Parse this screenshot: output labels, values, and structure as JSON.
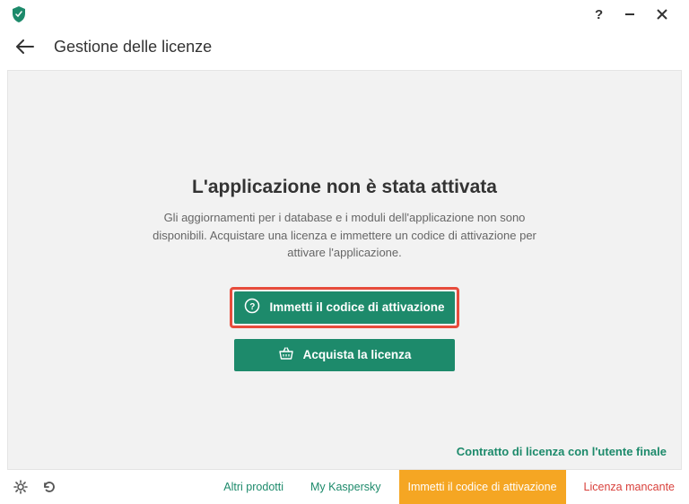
{
  "header": {
    "title": "Gestione delle licenze"
  },
  "main": {
    "heading": "L'applicazione non è stata attivata",
    "description": "Gli aggiornamenti per i database e i moduli dell'applicazione non sono disponibili. Acquistare una licenza e immettere un codice di attivazione per attivare l'applicazione.",
    "enter_code_label": "Immetti il codice di attivazione",
    "buy_license_label": "Acquista la licenza",
    "eula_link": "Contratto di licenza con l'utente finale"
  },
  "footer": {
    "other_products": "Altri prodotti",
    "my_kaspersky": "My Kaspersky",
    "enter_code": "Immetti il codice di attivazione",
    "license_missing": "Licenza mancante"
  }
}
